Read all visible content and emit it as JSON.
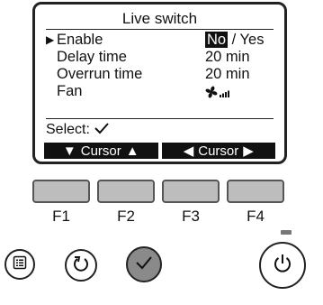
{
  "screen": {
    "title": "Live switch",
    "menu": [
      {
        "label": "Enable",
        "selected": true,
        "value_parts": [
          "No",
          " / Yes"
        ],
        "highlighted": "No"
      },
      {
        "label": "Delay time",
        "value": "20 min"
      },
      {
        "label": "Overrun time",
        "value": "20 min"
      },
      {
        "label": "Fan",
        "value_icon": "fan-speed-icon"
      }
    ],
    "select_label": "Select:",
    "softkeys": [
      {
        "left_arrow": "▼",
        "label": "Cursor",
        "right_arrow": "▲"
      },
      {
        "left_arrow": "◀",
        "label": "Cursor",
        "right_arrow": "▶"
      }
    ]
  },
  "function_keys": [
    "F1",
    "F2",
    "F3",
    "F4"
  ],
  "buttons": {
    "menu": "menu-icon",
    "back": "return-icon",
    "confirm": "checkmark-icon",
    "power": "power-icon"
  },
  "colors": {
    "lcd_fg": "#111111",
    "key_fill": "#bdbdbd",
    "confirm_fill": "#8a8a8a"
  }
}
